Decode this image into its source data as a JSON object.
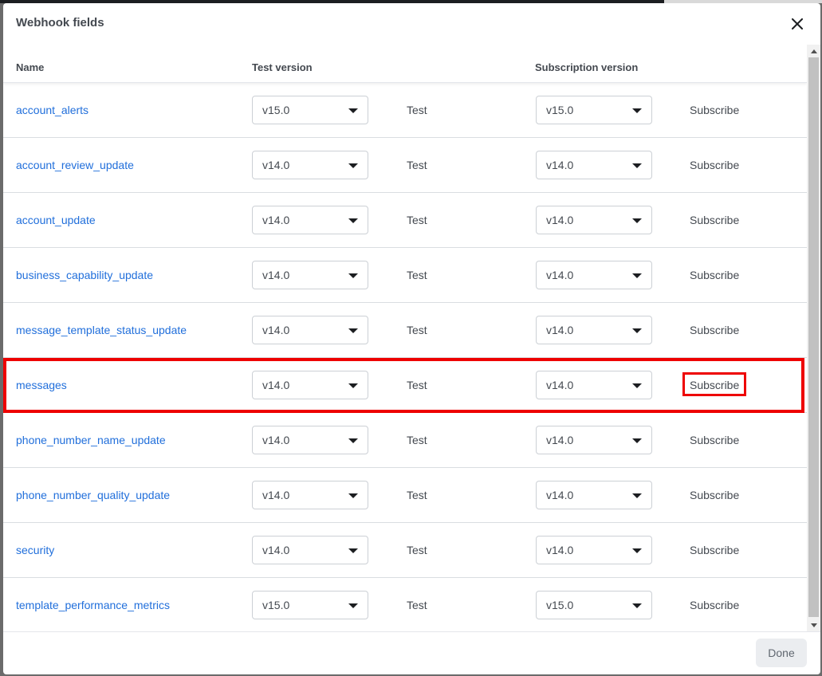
{
  "dialog": {
    "title": "Webhook fields",
    "done_label": "Done"
  },
  "columns": {
    "name": "Name",
    "test_version": "Test version",
    "subscription_version": "Subscription version"
  },
  "rows": [
    {
      "name": "account_alerts",
      "test_version": "v15.0",
      "test_label": "Test",
      "sub_version": "v15.0",
      "subscribe_label": "Subscribe"
    },
    {
      "name": "account_review_update",
      "test_version": "v14.0",
      "test_label": "Test",
      "sub_version": "v14.0",
      "subscribe_label": "Subscribe"
    },
    {
      "name": "account_update",
      "test_version": "v14.0",
      "test_label": "Test",
      "sub_version": "v14.0",
      "subscribe_label": "Subscribe"
    },
    {
      "name": "business_capability_update",
      "test_version": "v14.0",
      "test_label": "Test",
      "sub_version": "v14.0",
      "subscribe_label": "Subscribe"
    },
    {
      "name": "message_template_status_update",
      "test_version": "v14.0",
      "test_label": "Test",
      "sub_version": "v14.0",
      "subscribe_label": "Subscribe"
    },
    {
      "name": "messages",
      "test_version": "v14.0",
      "test_label": "Test",
      "sub_version": "v14.0",
      "subscribe_label": "Subscribe"
    },
    {
      "name": "phone_number_name_update",
      "test_version": "v14.0",
      "test_label": "Test",
      "sub_version": "v14.0",
      "subscribe_label": "Subscribe"
    },
    {
      "name": "phone_number_quality_update",
      "test_version": "v14.0",
      "test_label": "Test",
      "sub_version": "v14.0",
      "subscribe_label": "Subscribe"
    },
    {
      "name": "security",
      "test_version": "v14.0",
      "test_label": "Test",
      "sub_version": "v14.0",
      "subscribe_label": "Subscribe"
    },
    {
      "name": "template_performance_metrics",
      "test_version": "v15.0",
      "test_label": "Test",
      "sub_version": "v15.0",
      "subscribe_label": "Subscribe"
    }
  ],
  "icons": {
    "close": "close-icon",
    "select_caret": "chevron-down-icon"
  },
  "colors": {
    "link": "#216fdb",
    "highlight": "#ee0000"
  }
}
